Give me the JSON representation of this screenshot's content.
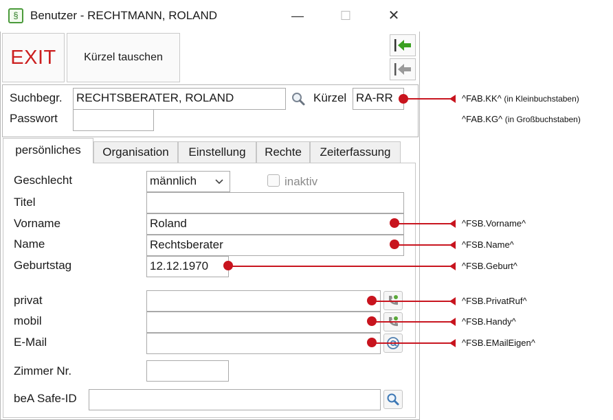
{
  "window": {
    "title": "Benutzer - RECHTMANN, ROLAND",
    "app_icon_glyph": "§",
    "minimize_glyph": "—",
    "maximize_glyph": "☐",
    "close_glyph": "✕"
  },
  "toolbar": {
    "exit_label": "EXIT",
    "swap_label": "Kürzel tauschen"
  },
  "header": {
    "search_label": "Suchbegr.",
    "search_value": "RECHTSBERATER, ROLAND",
    "kuerzel_label": "Kürzel",
    "kuerzel_value": "RA-RR",
    "password_label": "Passwort",
    "password_value": ""
  },
  "tabs": [
    {
      "label": "persönliches",
      "active": true
    },
    {
      "label": "Organisation",
      "active": false
    },
    {
      "label": "Einstellung",
      "active": false
    },
    {
      "label": "Rechte",
      "active": false
    },
    {
      "label": "Zeiterfassung",
      "active": false
    }
  ],
  "form": {
    "gender_label": "Geschlecht",
    "gender_value": "männlich",
    "inactive_label": "inaktiv",
    "inactive_checked": false,
    "title_label": "Titel",
    "title_value": "",
    "firstname_label": "Vorname",
    "firstname_value": "Roland",
    "lastname_label": "Name",
    "lastname_value": "Rechtsberater",
    "birthday_label": "Geburtstag",
    "birthday_value": "12.12.1970",
    "private_label": "privat",
    "private_value": "",
    "mobile_label": "mobil",
    "mobile_value": "",
    "email_label": "E-Mail",
    "email_value": "",
    "room_label": "Zimmer Nr.",
    "room_value": "",
    "bea_label": "beA Safe-ID",
    "bea_value": ""
  },
  "annotations": {
    "kk": "^FAB.KK^",
    "kk_note": "(in Kleinbuchstaben)",
    "kg": "^FAB.KG^",
    "kg_note": "(in Großbuchstaben)",
    "vorname": "^FSB.Vorname^",
    "name": "^FSB.Name^",
    "geburt": "^FSB.Geburt^",
    "privatruf": "^FSB.PrivatRuf^",
    "handy": "^FSB.Handy^",
    "email": "^FSB.EMailEigen^"
  },
  "colors": {
    "annotation_red": "#c8141e",
    "exit_red": "#cc1f1f",
    "nav_green": "#3aa020"
  }
}
